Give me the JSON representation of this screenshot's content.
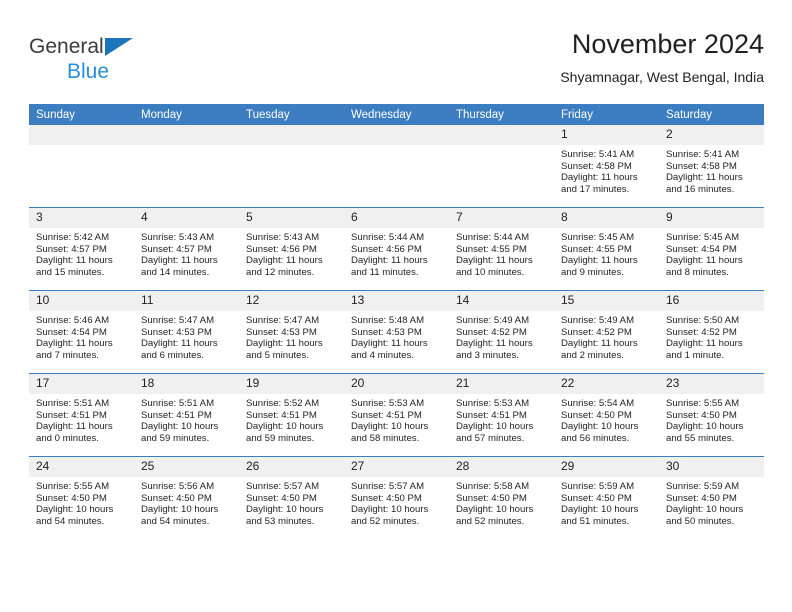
{
  "brand": {
    "line1": "General",
    "line2": "Blue",
    "triangle_color": "#1b75bb",
    "line2_color": "#2a8fd8"
  },
  "header": {
    "title": "November 2024",
    "subtitle": "Shyamnagar, West Bengal, India"
  },
  "theme": {
    "header_blue": "#3b7dc0",
    "daynum_band": "#f0f0f0",
    "text": "#231f20"
  },
  "weekday_headers": [
    "Sunday",
    "Monday",
    "Tuesday",
    "Wednesday",
    "Thursday",
    "Friday",
    "Saturday"
  ],
  "weeks": [
    [
      {
        "day": "",
        "empty": true
      },
      {
        "day": "",
        "empty": true
      },
      {
        "day": "",
        "empty": true
      },
      {
        "day": "",
        "empty": true
      },
      {
        "day": "",
        "empty": true
      },
      {
        "day": "1",
        "sunrise": "Sunrise: 5:41 AM",
        "sunset": "Sunset: 4:58 PM",
        "daylight1": "Daylight: 11 hours",
        "daylight2": "and 17 minutes."
      },
      {
        "day": "2",
        "sunrise": "Sunrise: 5:41 AM",
        "sunset": "Sunset: 4:58 PM",
        "daylight1": "Daylight: 11 hours",
        "daylight2": "and 16 minutes."
      }
    ],
    [
      {
        "day": "3",
        "sunrise": "Sunrise: 5:42 AM",
        "sunset": "Sunset: 4:57 PM",
        "daylight1": "Daylight: 11 hours",
        "daylight2": "and 15 minutes."
      },
      {
        "day": "4",
        "sunrise": "Sunrise: 5:43 AM",
        "sunset": "Sunset: 4:57 PM",
        "daylight1": "Daylight: 11 hours",
        "daylight2": "and 14 minutes."
      },
      {
        "day": "5",
        "sunrise": "Sunrise: 5:43 AM",
        "sunset": "Sunset: 4:56 PM",
        "daylight1": "Daylight: 11 hours",
        "daylight2": "and 12 minutes."
      },
      {
        "day": "6",
        "sunrise": "Sunrise: 5:44 AM",
        "sunset": "Sunset: 4:56 PM",
        "daylight1": "Daylight: 11 hours",
        "daylight2": "and 11 minutes."
      },
      {
        "day": "7",
        "sunrise": "Sunrise: 5:44 AM",
        "sunset": "Sunset: 4:55 PM",
        "daylight1": "Daylight: 11 hours",
        "daylight2": "and 10 minutes."
      },
      {
        "day": "8",
        "sunrise": "Sunrise: 5:45 AM",
        "sunset": "Sunset: 4:55 PM",
        "daylight1": "Daylight: 11 hours",
        "daylight2": "and 9 minutes."
      },
      {
        "day": "9",
        "sunrise": "Sunrise: 5:45 AM",
        "sunset": "Sunset: 4:54 PM",
        "daylight1": "Daylight: 11 hours",
        "daylight2": "and 8 minutes."
      }
    ],
    [
      {
        "day": "10",
        "sunrise": "Sunrise: 5:46 AM",
        "sunset": "Sunset: 4:54 PM",
        "daylight1": "Daylight: 11 hours",
        "daylight2": "and 7 minutes."
      },
      {
        "day": "11",
        "sunrise": "Sunrise: 5:47 AM",
        "sunset": "Sunset: 4:53 PM",
        "daylight1": "Daylight: 11 hours",
        "daylight2": "and 6 minutes."
      },
      {
        "day": "12",
        "sunrise": "Sunrise: 5:47 AM",
        "sunset": "Sunset: 4:53 PM",
        "daylight1": "Daylight: 11 hours",
        "daylight2": "and 5 minutes."
      },
      {
        "day": "13",
        "sunrise": "Sunrise: 5:48 AM",
        "sunset": "Sunset: 4:53 PM",
        "daylight1": "Daylight: 11 hours",
        "daylight2": "and 4 minutes."
      },
      {
        "day": "14",
        "sunrise": "Sunrise: 5:49 AM",
        "sunset": "Sunset: 4:52 PM",
        "daylight1": "Daylight: 11 hours",
        "daylight2": "and 3 minutes."
      },
      {
        "day": "15",
        "sunrise": "Sunrise: 5:49 AM",
        "sunset": "Sunset: 4:52 PM",
        "daylight1": "Daylight: 11 hours",
        "daylight2": "and 2 minutes."
      },
      {
        "day": "16",
        "sunrise": "Sunrise: 5:50 AM",
        "sunset": "Sunset: 4:52 PM",
        "daylight1": "Daylight: 11 hours",
        "daylight2": "and 1 minute."
      }
    ],
    [
      {
        "day": "17",
        "sunrise": "Sunrise: 5:51 AM",
        "sunset": "Sunset: 4:51 PM",
        "daylight1": "Daylight: 11 hours",
        "daylight2": "and 0 minutes."
      },
      {
        "day": "18",
        "sunrise": "Sunrise: 5:51 AM",
        "sunset": "Sunset: 4:51 PM",
        "daylight1": "Daylight: 10 hours",
        "daylight2": "and 59 minutes."
      },
      {
        "day": "19",
        "sunrise": "Sunrise: 5:52 AM",
        "sunset": "Sunset: 4:51 PM",
        "daylight1": "Daylight: 10 hours",
        "daylight2": "and 59 minutes."
      },
      {
        "day": "20",
        "sunrise": "Sunrise: 5:53 AM",
        "sunset": "Sunset: 4:51 PM",
        "daylight1": "Daylight: 10 hours",
        "daylight2": "and 58 minutes."
      },
      {
        "day": "21",
        "sunrise": "Sunrise: 5:53 AM",
        "sunset": "Sunset: 4:51 PM",
        "daylight1": "Daylight: 10 hours",
        "daylight2": "and 57 minutes."
      },
      {
        "day": "22",
        "sunrise": "Sunrise: 5:54 AM",
        "sunset": "Sunset: 4:50 PM",
        "daylight1": "Daylight: 10 hours",
        "daylight2": "and 56 minutes."
      },
      {
        "day": "23",
        "sunrise": "Sunrise: 5:55 AM",
        "sunset": "Sunset: 4:50 PM",
        "daylight1": "Daylight: 10 hours",
        "daylight2": "and 55 minutes."
      }
    ],
    [
      {
        "day": "24",
        "sunrise": "Sunrise: 5:55 AM",
        "sunset": "Sunset: 4:50 PM",
        "daylight1": "Daylight: 10 hours",
        "daylight2": "and 54 minutes."
      },
      {
        "day": "25",
        "sunrise": "Sunrise: 5:56 AM",
        "sunset": "Sunset: 4:50 PM",
        "daylight1": "Daylight: 10 hours",
        "daylight2": "and 54 minutes."
      },
      {
        "day": "26",
        "sunrise": "Sunrise: 5:57 AM",
        "sunset": "Sunset: 4:50 PM",
        "daylight1": "Daylight: 10 hours",
        "daylight2": "and 53 minutes."
      },
      {
        "day": "27",
        "sunrise": "Sunrise: 5:57 AM",
        "sunset": "Sunset: 4:50 PM",
        "daylight1": "Daylight: 10 hours",
        "daylight2": "and 52 minutes."
      },
      {
        "day": "28",
        "sunrise": "Sunrise: 5:58 AM",
        "sunset": "Sunset: 4:50 PM",
        "daylight1": "Daylight: 10 hours",
        "daylight2": "and 52 minutes."
      },
      {
        "day": "29",
        "sunrise": "Sunrise: 5:59 AM",
        "sunset": "Sunset: 4:50 PM",
        "daylight1": "Daylight: 10 hours",
        "daylight2": "and 51 minutes."
      },
      {
        "day": "30",
        "sunrise": "Sunrise: 5:59 AM",
        "sunset": "Sunset: 4:50 PM",
        "daylight1": "Daylight: 10 hours",
        "daylight2": "and 50 minutes."
      }
    ]
  ]
}
